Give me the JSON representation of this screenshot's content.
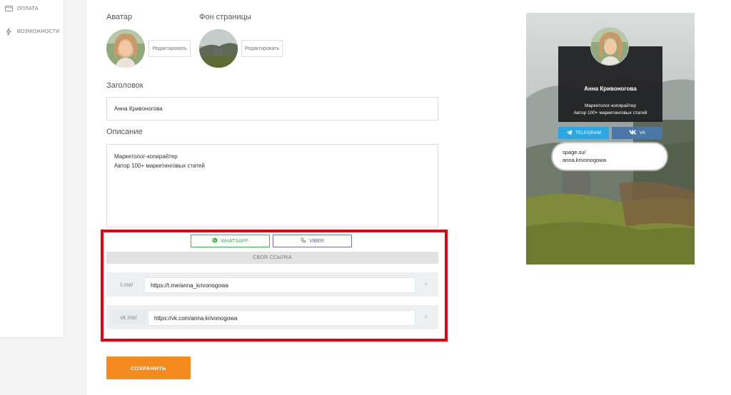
{
  "sidebar": {
    "items": [
      {
        "label": "ОПЛАТА",
        "icon": "card-icon"
      },
      {
        "label": "ВОЗМОЖНОСТИ",
        "icon": "lightning-icon"
      }
    ]
  },
  "form": {
    "avatar_label": "Аватар",
    "background_label": "Фон страницы",
    "edit_avatar_label": "Редактировать",
    "edit_background_label": "Редактировать",
    "title_label": "Заголовок",
    "title_value": "Анна Кривоногова",
    "description_label": "Описание",
    "description_lines": [
      "Маркетолог-копирайтер",
      "Автор 100+ маркетинговых статей"
    ]
  },
  "links": {
    "whatsapp_label": "WHATSAPP",
    "viber_label": "VIBER",
    "custom_link_label": "СВОЯ ССЫЛКА",
    "rows": [
      {
        "prefix": "t.me/",
        "value": "https://t.me/anna_krivonogowa",
        "remove": "×"
      },
      {
        "prefix": "vk.me/",
        "value": "https://vk.com/anna.krivonogowa",
        "remove": "×"
      }
    ],
    "colors": {
      "whatsapp": "#3cb64a",
      "viber": "#7b6ca8",
      "highlight": "#e8000f"
    }
  },
  "save_label": "СОХРАНИТЬ",
  "preview": {
    "name": "Анна Кривоногова",
    "desc_lines": [
      "Маркетолог-копирайтер",
      "Автор 100+ маркетинговых статей"
    ],
    "telegram_label": "TELEGRAM",
    "vk_label": "VK",
    "url_line1": "spage.su/",
    "url_line2": "anna.krivonogowa",
    "colors": {
      "telegram": "#2ea6df",
      "vk": "#4a76a8"
    }
  }
}
